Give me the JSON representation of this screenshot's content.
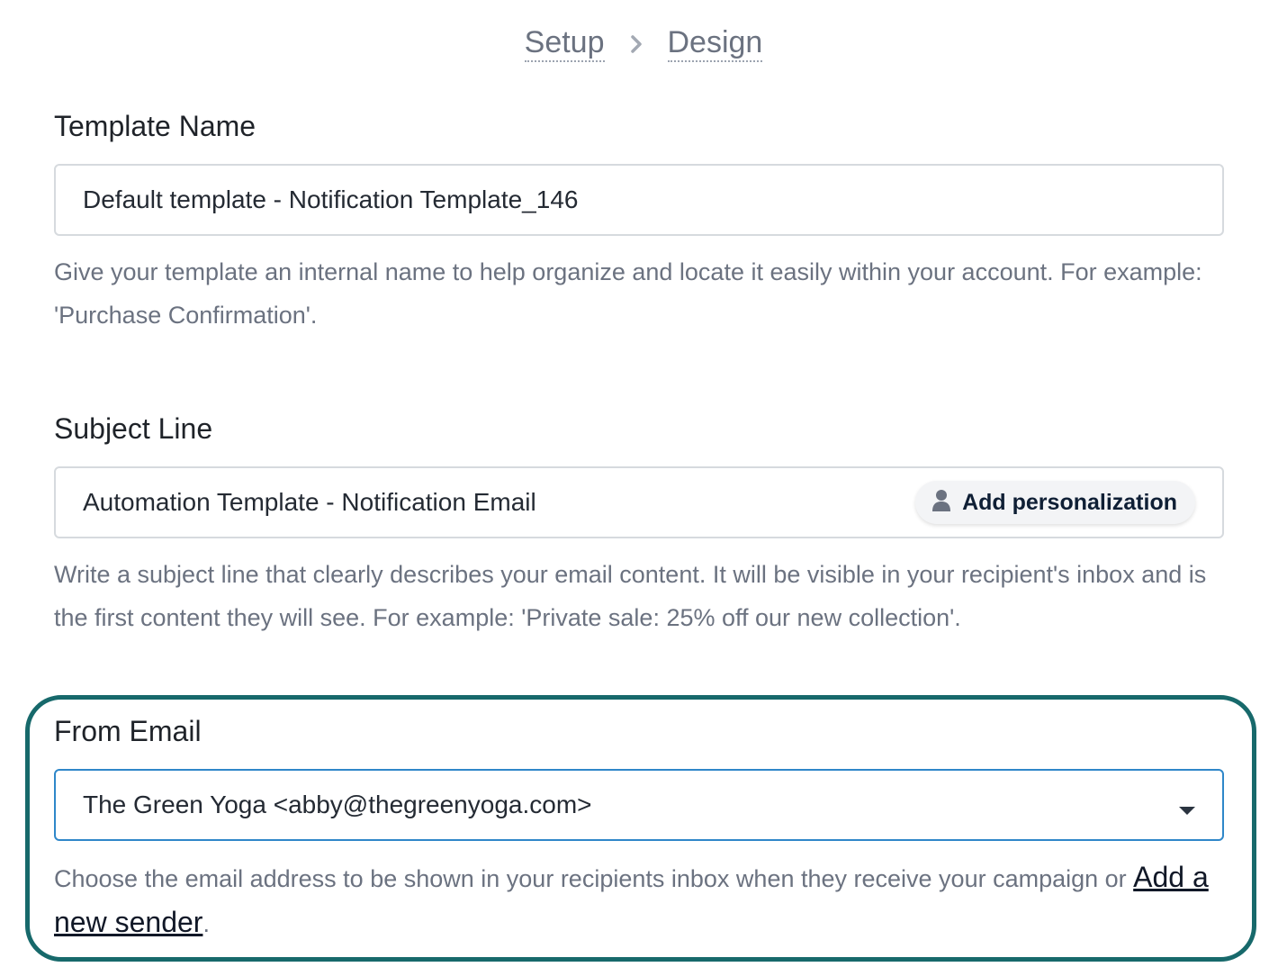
{
  "breadcrumb": {
    "steps": [
      "Setup",
      "Design"
    ]
  },
  "template_name": {
    "label": "Template Name",
    "value": "Default template - Notification Template_146",
    "help": "Give your template an internal name to help organize and locate it easily within your account. For example: 'Purchase Confirmation'."
  },
  "subject_line": {
    "label": "Subject Line",
    "value": "Automation Template - Notification Email",
    "personalize_label": "Add personalization",
    "help": "Write a subject line that clearly describes your email content. It will be visible in your recipient's inbox and is the first content they will see. For example: 'Private sale: 25% off our new collection'."
  },
  "from_email": {
    "label": "From Email",
    "value": "The Green Yoga <abby@thegreenyoga.com>",
    "help_before": "Choose the email address to be shown in your recipients inbox when they receive your campaign or ",
    "link_label": "Add a new sender",
    "help_after": "."
  },
  "colors": {
    "highlight": "#17696b",
    "focus_border": "#2f87c9",
    "help_text": "#6b7280"
  },
  "icons": [
    "chevron-right-icon",
    "user-icon",
    "caret-down-icon"
  ]
}
